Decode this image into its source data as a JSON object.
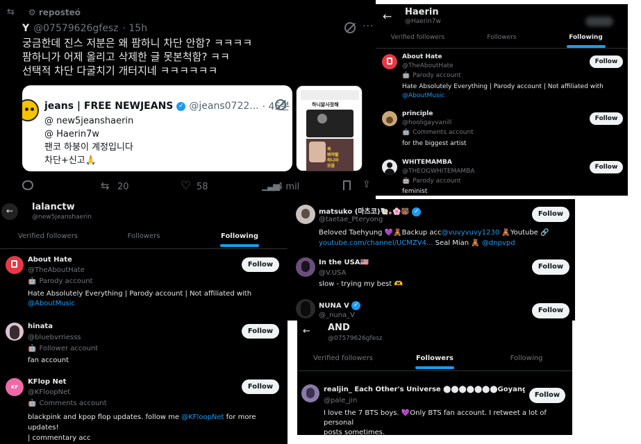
{
  "tweet": {
    "repost_label": "reposteó",
    "author_name": "Y",
    "author_handle": "@07579626gfesz",
    "time": "· 15h",
    "text_lines": [
      "궁금한데 진스 저분은 왜 팜하니 차단 안함? ㅋㅋㅋㅋ",
      "팜하니가 어제 올리고 삭제한 글 못본척함? ㅋㅋ",
      "선택적 차단 다굴치기 개터지네 ㅋㅋㅋㅋㅋㅋ"
    ],
    "quote": {
      "name": "jeans | FREE NEWJEANS",
      "handle": "@jeans0722...",
      "time": "· 45분",
      "lines": [
        "@ new5jeanshaerin",
        "@ Haerin7w",
        "팬코 하붕이 계정입니다",
        "차단+신고🙏"
      ]
    },
    "thumb": {
      "top": "하니앓사정해",
      "bottom1": "꼭",
      "bottom2": "봐야할",
      "bottom3": "하니아",
      "bottom4": "모음"
    },
    "actions": {
      "retweets": "20",
      "likes": "58",
      "views": "4 mil"
    }
  },
  "haerin_panel": {
    "title": "Haerin",
    "handle": "@Haerin7w",
    "tabs": [
      "Verified followers",
      "Followers",
      "Following"
    ],
    "users": [
      {
        "name": "About Hate",
        "handle": "@TheAboutHate",
        "label": "Parody account",
        "bio": "Hate Absolutely Everything | Parody account | Not affiliated with",
        "bio_link": "@AboutMusic",
        "button": "Follow"
      },
      {
        "name": "principle",
        "handle": "@hooligayvanill",
        "label": "Comments account",
        "bio": "for the biggest artist",
        "button": "Follow"
      },
      {
        "name": "WHITEMAMBA",
        "handle": "@THEOGWHITEMAMBA",
        "label": "Parody account",
        "bio": "feminist",
        "button": "Follow"
      }
    ]
  },
  "lalanctw_panel": {
    "title": "lalanctw",
    "handle": "@new5jeanshaerin",
    "tabs": [
      "Verified followers",
      "Followers",
      "Following"
    ],
    "users": [
      {
        "name": "About Hate",
        "handle": "@TheAboutHate",
        "label": "Parody account",
        "bio": "Hate Absolutely Everything | Parody account | Not affiliated with",
        "bio_link": "@AboutMusic",
        "button": "Follow"
      },
      {
        "name": "hinata",
        "handle": "@bluebvrriesss",
        "label": "Follower account",
        "bio": "fan account",
        "button": "Follow"
      },
      {
        "name": "KFlop Net",
        "handle": "@KFloopNet",
        "label": "Comments account",
        "bio": "blackpink and kpop flop updates. follow me ",
        "bio_link": "@KFloopNet",
        "bio_end": " for more updates!",
        "bio2": "| commentary acc",
        "button": "Follow"
      }
    ]
  },
  "mid_panel": {
    "users": [
      {
        "name": "matsuko (마츠코)🐚｡🌸🐻",
        "handle": "@taetae_Pteryong",
        "bio1": "Beloved Taehyung 💜🧸Backup acc",
        "bio1_link": "@vuvyvuvy1230",
        "bio1_end": " 🧸Youtube 🔗",
        "bio2_link": "youtube.com/channel/UCMZV4...",
        "bio2_mid": " Seal Mian 🧸 ",
        "bio2_link2": "@dnpvpd",
        "button": "Follow"
      },
      {
        "name": "In the USA🇺🇸",
        "handle": "@V.USA",
        "bio": "slow - trying my best 🫶",
        "button": "Follow"
      },
      {
        "name": "NUNA V",
        "handle": "@_nuna_V",
        "button": "Follow"
      }
    ]
  },
  "and_panel": {
    "title": "AND",
    "handle": "@07579626gfesz",
    "tabs": [
      "Verified followers",
      "Followers",
      "Following"
    ],
    "user": {
      "name": "realjin_ Each Other's Universe ⬤⬤⬤⬤⬤⬤⬤Goyang|/Busan...",
      "handle": "@pale_jin",
      "bio1": "I love the 7 BTS boys. 💜Only BTS fan account. I retweet a lot of personal",
      "bio2": "posts sometimes.",
      "button": "Follow"
    }
  },
  "colors": {
    "bg": "#000000",
    "accent": "#1d9bf0",
    "muted": "#71767b",
    "text": "#e7e9ea"
  }
}
